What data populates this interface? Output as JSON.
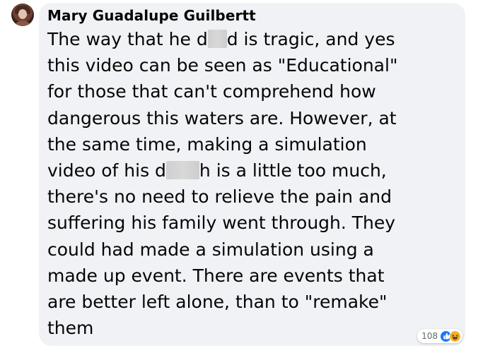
{
  "comment": {
    "author": "Mary Guadalupe Guilbertt",
    "lines": [
      {
        "segments": [
          {
            "text": "The way that he d"
          },
          {
            "censor": true,
            "width": 0
          },
          {
            "text": "d is tragic, and yes"
          }
        ]
      },
      {
        "segments": [
          {
            "text": "this video can be seen as \"Educational\""
          }
        ]
      },
      {
        "segments": [
          {
            "text": "for those that can't comprehend how"
          }
        ]
      },
      {
        "segments": [
          {
            "text": "dangerous this waters are. However, at"
          }
        ]
      },
      {
        "segments": [
          {
            "text": "the same time, making a simulation"
          }
        ]
      },
      {
        "segments": [
          {
            "text": "video of his d"
          },
          {
            "censor": true
          },
          {
            "text": "h is a little too much,"
          }
        ]
      },
      {
        "segments": [
          {
            "text": "there's no need to relieve the pain and"
          }
        ]
      },
      {
        "segments": [
          {
            "text": "suffering his family went through. They"
          }
        ]
      },
      {
        "segments": [
          {
            "text": "could had made a simulation using a"
          }
        ]
      },
      {
        "segments": [
          {
            "text": "made up event. There are events that"
          }
        ]
      },
      {
        "segments": [
          {
            "text": "are better left alone, than to \"remake\""
          }
        ]
      },
      {
        "segments": [
          {
            "text": "them"
          }
        ]
      }
    ]
  },
  "reactions": {
    "count": "108",
    "icons": [
      "like-icon",
      "haha-icon"
    ],
    "colors": {
      "like": "#1877f2",
      "haha": "#f7b125"
    }
  },
  "colors": {
    "bubble": "#f0f2f5",
    "text": "#050505",
    "muted": "#65676b"
  }
}
